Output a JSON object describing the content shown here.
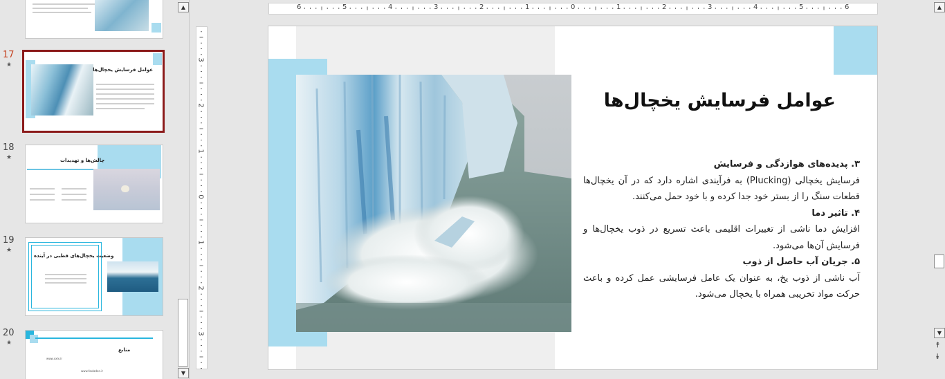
{
  "thumbnails": [
    {
      "number": "17",
      "title": "عوامل فرسایش یخچال‌ها",
      "selected": true
    },
    {
      "number": "18",
      "title": "چالش‌ها و تهدیدات",
      "selected": false
    },
    {
      "number": "19",
      "title": "وضعیت یخچال‌های قطبی در آینده",
      "selected": false
    },
    {
      "number": "20",
      "title": "منابع",
      "selected": false,
      "links": [
        "www.xxlx.ir",
        "www.faxladen.ir"
      ]
    }
  ],
  "thumb_star": "★",
  "ruler": {
    "horizontal": [
      "6",
      "5",
      "4",
      "3",
      "2",
      "1",
      "0",
      "1",
      "2",
      "3",
      "4",
      "5",
      "6"
    ],
    "vertical": [
      "3",
      "2",
      "1",
      "0",
      "1",
      "2",
      "3"
    ]
  },
  "slide": {
    "title": "عوامل فرسایش یخچال‌ها",
    "sections": [
      {
        "heading": "۳.  پدیده‌های هوازدگی و فرسایش",
        "text": "فرسایش یخچالی (Plucking) به فرآیندی اشاره دارد که در آن یخچال‌ها قطعات سنگ را از بستر خود جدا کرده و با خود حمل می‌کنند."
      },
      {
        "heading": "۴.  تاثیر دما",
        "text": "افزایش دما ناشی از تغییرات اقلیمی باعث تسریع در ذوب یخچال‌ها و فرسایش آن‌ها می‌شود."
      },
      {
        "heading": "۵.  جریان آب حاصل از ذوب",
        "text": "آب ناشی از ذوب یخ، به عنوان یک عامل فرسایشی عمل کرده و باعث حرکت مواد تخریبی همراه با یخچال می‌شود."
      }
    ]
  },
  "colors": {
    "accent_blue": "#a9dcef",
    "selection": "#8b1a1a",
    "active_number": "#c43e1c"
  },
  "icons": {
    "scroll_up": "▲",
    "scroll_down": "▼",
    "prev_slide": "⯭",
    "next_slide": "⯯"
  }
}
